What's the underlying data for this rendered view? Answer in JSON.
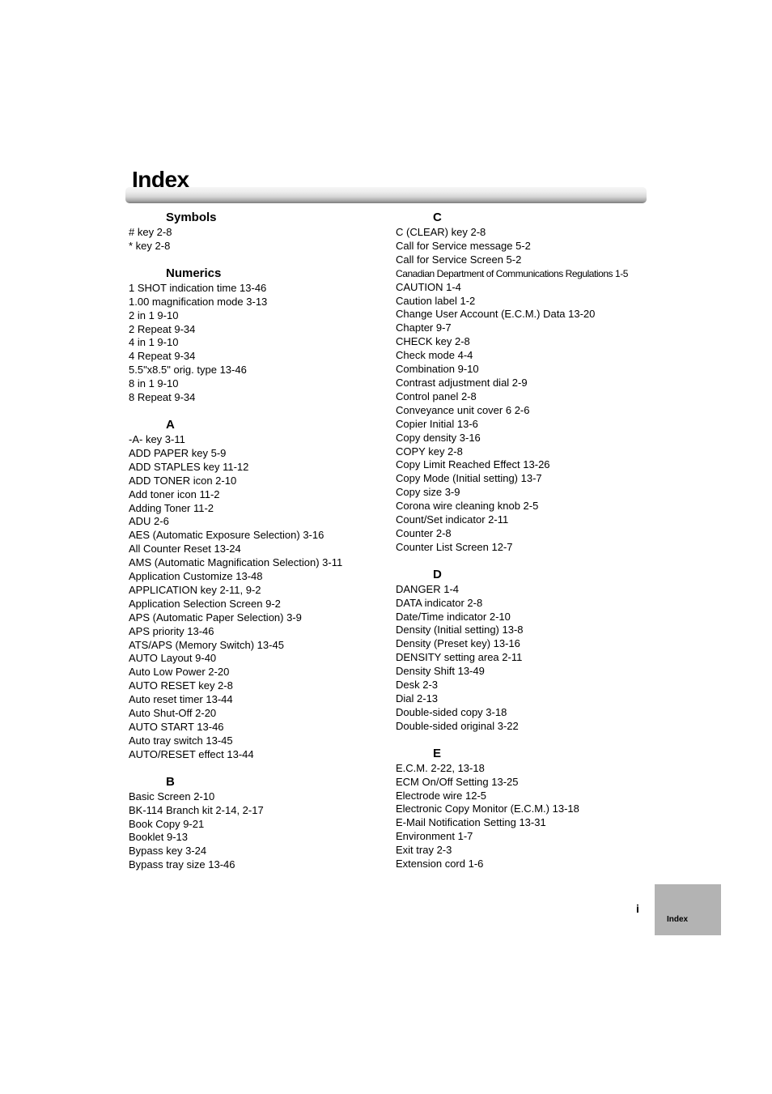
{
  "page": {
    "title": "Index",
    "page_number": "i",
    "tab_label": "Index"
  },
  "columns": [
    {
      "sections": [
        {
          "heading": "Symbols",
          "entries": [
            "# key 2-8",
            "* key 2-8"
          ]
        },
        {
          "heading": "Numerics",
          "entries": [
            "1 SHOT indication time 13-46",
            "1.00 magnification mode 3-13",
            "2 in 1 9-10",
            "2 Repeat 9-34",
            "4 in 1 9-10",
            "4 Repeat 9-34",
            "5.5\"x8.5\" orig. type 13-46",
            "8 in 1 9-10",
            "8 Repeat 9-34"
          ]
        },
        {
          "heading": "A",
          "entries": [
            "-A- key 3-11",
            "ADD PAPER key 5-9",
            "ADD STAPLES key 11-12",
            "ADD TONER icon 2-10",
            "Add toner icon 11-2",
            "Adding Toner 11-2",
            "ADU 2-6",
            "AES (Automatic Exposure Selection) 3-16",
            "All Counter Reset 13-24",
            "AMS (Automatic Magnification Selection) 3-11",
            "Application Customize 13-48",
            "APPLICATION key 2-11, 9-2",
            "Application Selection Screen 9-2",
            "APS (Automatic Paper Selection) 3-9",
            "APS priority 13-46",
            "ATS/APS (Memory Switch) 13-45",
            "AUTO Layout 9-40",
            "Auto Low Power 2-20",
            "AUTO RESET key 2-8",
            "Auto reset timer 13-44",
            "Auto Shut-Off 2-20",
            "AUTO START 13-46",
            "Auto tray switch 13-45",
            "AUTO/RESET effect 13-44"
          ]
        },
        {
          "heading": "B",
          "entries": [
            "Basic Screen 2-10",
            "BK-114 Branch kit 2-14, 2-17",
            "Book Copy 9-21",
            "Booklet 9-13",
            "Bypass key 3-24",
            "Bypass tray size 13-46"
          ]
        }
      ]
    },
    {
      "sections": [
        {
          "heading": "C",
          "entries": [
            "C (CLEAR) key 2-8",
            "Call for Service message 5-2",
            "Call for Service Screen 5-2",
            "Canadian Department of Communications Regulations 1-5",
            "CAUTION 1-4",
            "Caution label 1-2",
            "Change User Account (E.C.M.) Data 13-20",
            "Chapter 9-7",
            "CHECK key 2-8",
            "Check mode 4-4",
            "Combination 9-10",
            "Contrast adjustment dial 2-9",
            "Control panel 2-8",
            "Conveyance unit cover 6 2-6",
            "Copier Initial 13-6",
            "Copy density 3-16",
            "COPY key 2-8",
            "Copy Limit Reached Effect 13-26",
            "Copy Mode (Initial setting) 13-7",
            "Copy size 3-9",
            "Corona wire cleaning knob 2-5",
            "Count/Set indicator 2-11",
            "Counter 2-8",
            "Counter List Screen 12-7"
          ]
        },
        {
          "heading": "D",
          "entries": [
            "DANGER 1-4",
            "DATA indicator 2-8",
            "Date/Time indicator 2-10",
            "Density (Initial setting) 13-8",
            "Density (Preset key) 13-16",
            "DENSITY setting area 2-11",
            "Density Shift 13-49",
            "Desk 2-3",
            "Dial 2-13",
            "Double-sided copy 3-18",
            "Double-sided original 3-22"
          ]
        },
        {
          "heading": "E",
          "entries": [
            "E.C.M. 2-22, 13-18",
            "ECM On/Off Setting 13-25",
            "Electrode wire 12-5",
            "Electronic Copy Monitor (E.C.M.) 13-18",
            "E-Mail Notification Setting 13-31",
            "Environment 1-7",
            "Exit tray 2-3",
            "Extension cord 1-6"
          ]
        }
      ]
    }
  ]
}
